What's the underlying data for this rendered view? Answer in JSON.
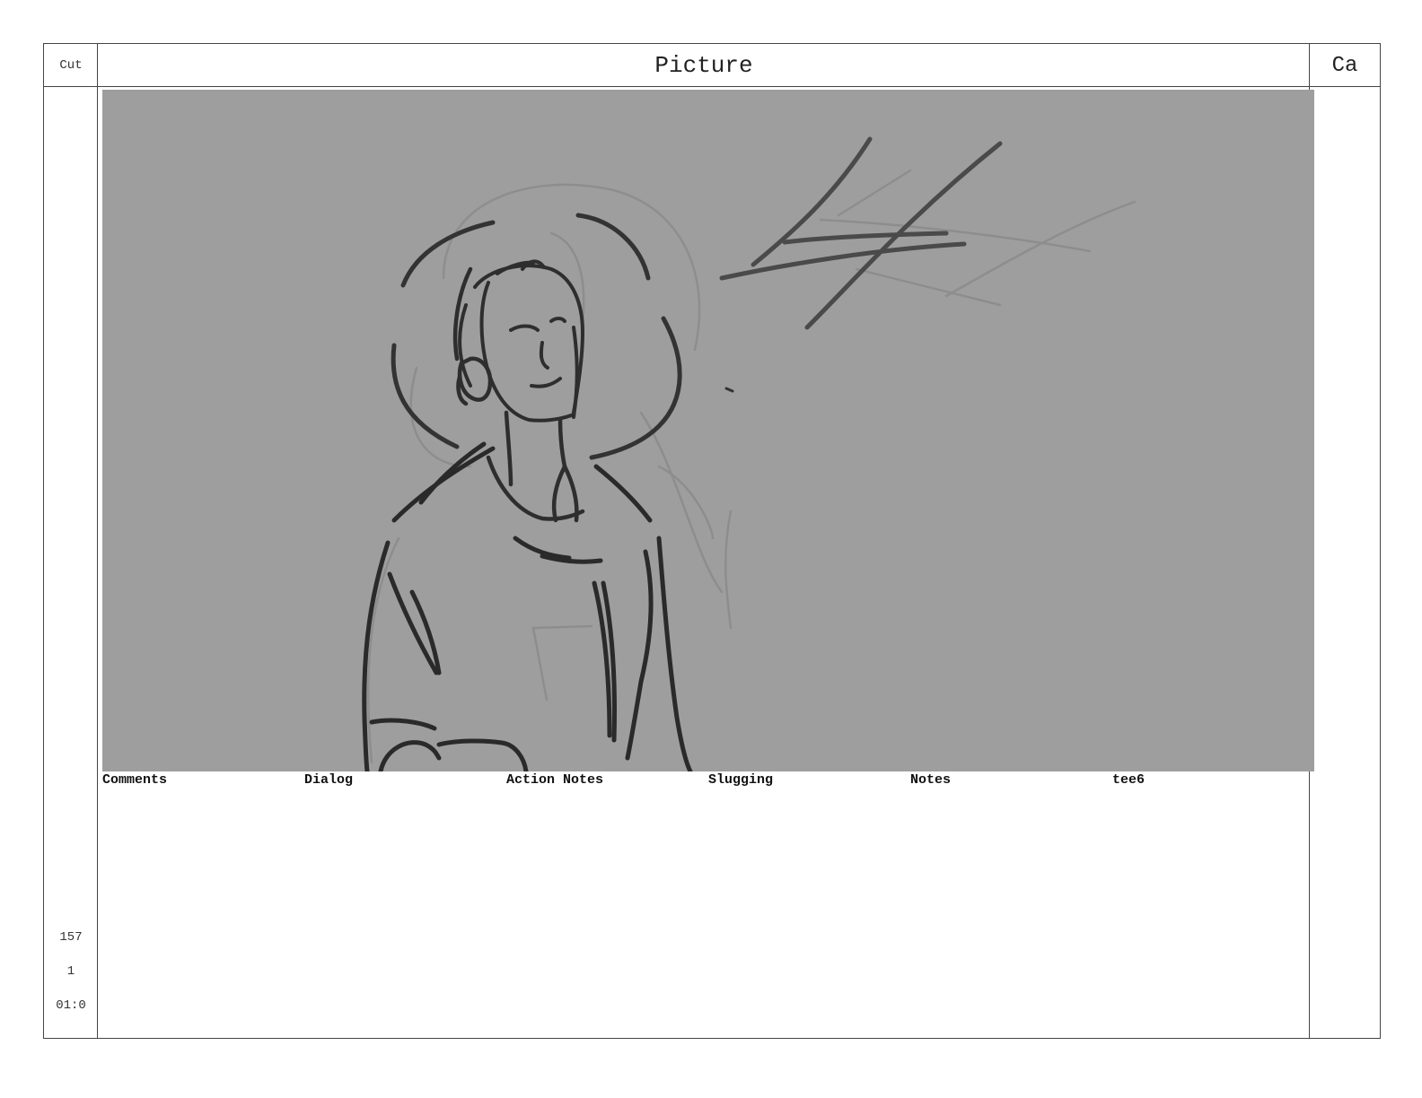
{
  "header": {
    "cut_label": "Cut",
    "picture_label": "Picture",
    "camera_label": "Ca"
  },
  "panel": {
    "background_color": "#9e9e9e",
    "illustration": "sketch-of-person-with-headphones"
  },
  "fields": [
    {
      "label": "Comments"
    },
    {
      "label": "Dialog"
    },
    {
      "label": "Action Notes"
    },
    {
      "label": "Slugging"
    },
    {
      "label": "Notes"
    },
    {
      "label": "tee6"
    }
  ],
  "cut_info": {
    "panel_number": "157",
    "sub_number": "1",
    "duration": "01:0"
  }
}
